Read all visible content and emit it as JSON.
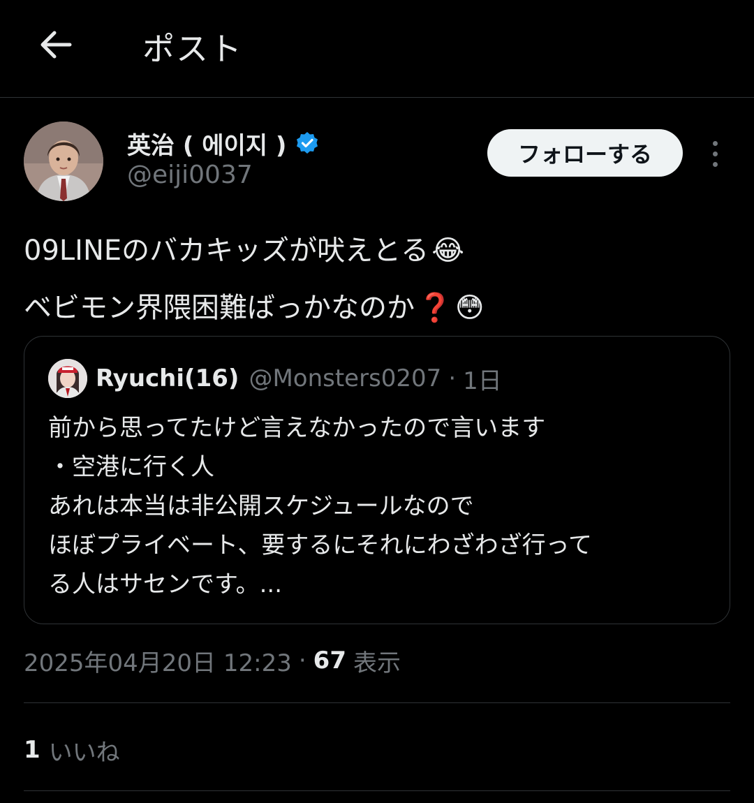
{
  "header": {
    "title": "ポスト",
    "back_icon": "arrow-left-icon"
  },
  "author": {
    "display_name": "英治 ( 에이지 )",
    "handle": "@eiji0037",
    "verified": true,
    "verified_color": "#1d9bf0",
    "follow_label": "フォローする",
    "more_icon": "more-vertical-icon"
  },
  "post": {
    "line1_text": "09LINEのバカキッズが吠えとる",
    "line1_emoji": "😂",
    "line2_text": "ベビモン界隈困難ばっかなのか",
    "line2_emoji_1": "❓",
    "line2_emoji_2": "😳"
  },
  "quote": {
    "name": "Ryuchi(16)",
    "handle": "@Monsters0207",
    "separator": "·",
    "time": "1日",
    "lines": [
      "前から思ってたけど言えなかったので言います",
      "・空港に行く人",
      "あれは本当は非公開スケジュールなので",
      "ほぼプライベート、要するにそれにわざわざ行って",
      "る人はサセンです。..."
    ]
  },
  "meta": {
    "timestamp": "2025年04月20日 12:23",
    "separator": "·",
    "views_count": "67",
    "views_label": "表示"
  },
  "likes": {
    "count": "1",
    "label": "いいね"
  },
  "colors": {
    "background": "#000000",
    "text": "#e7e9ea",
    "secondary": "#71767b",
    "border": "#2f3336",
    "accent": "#1d9bf0"
  }
}
